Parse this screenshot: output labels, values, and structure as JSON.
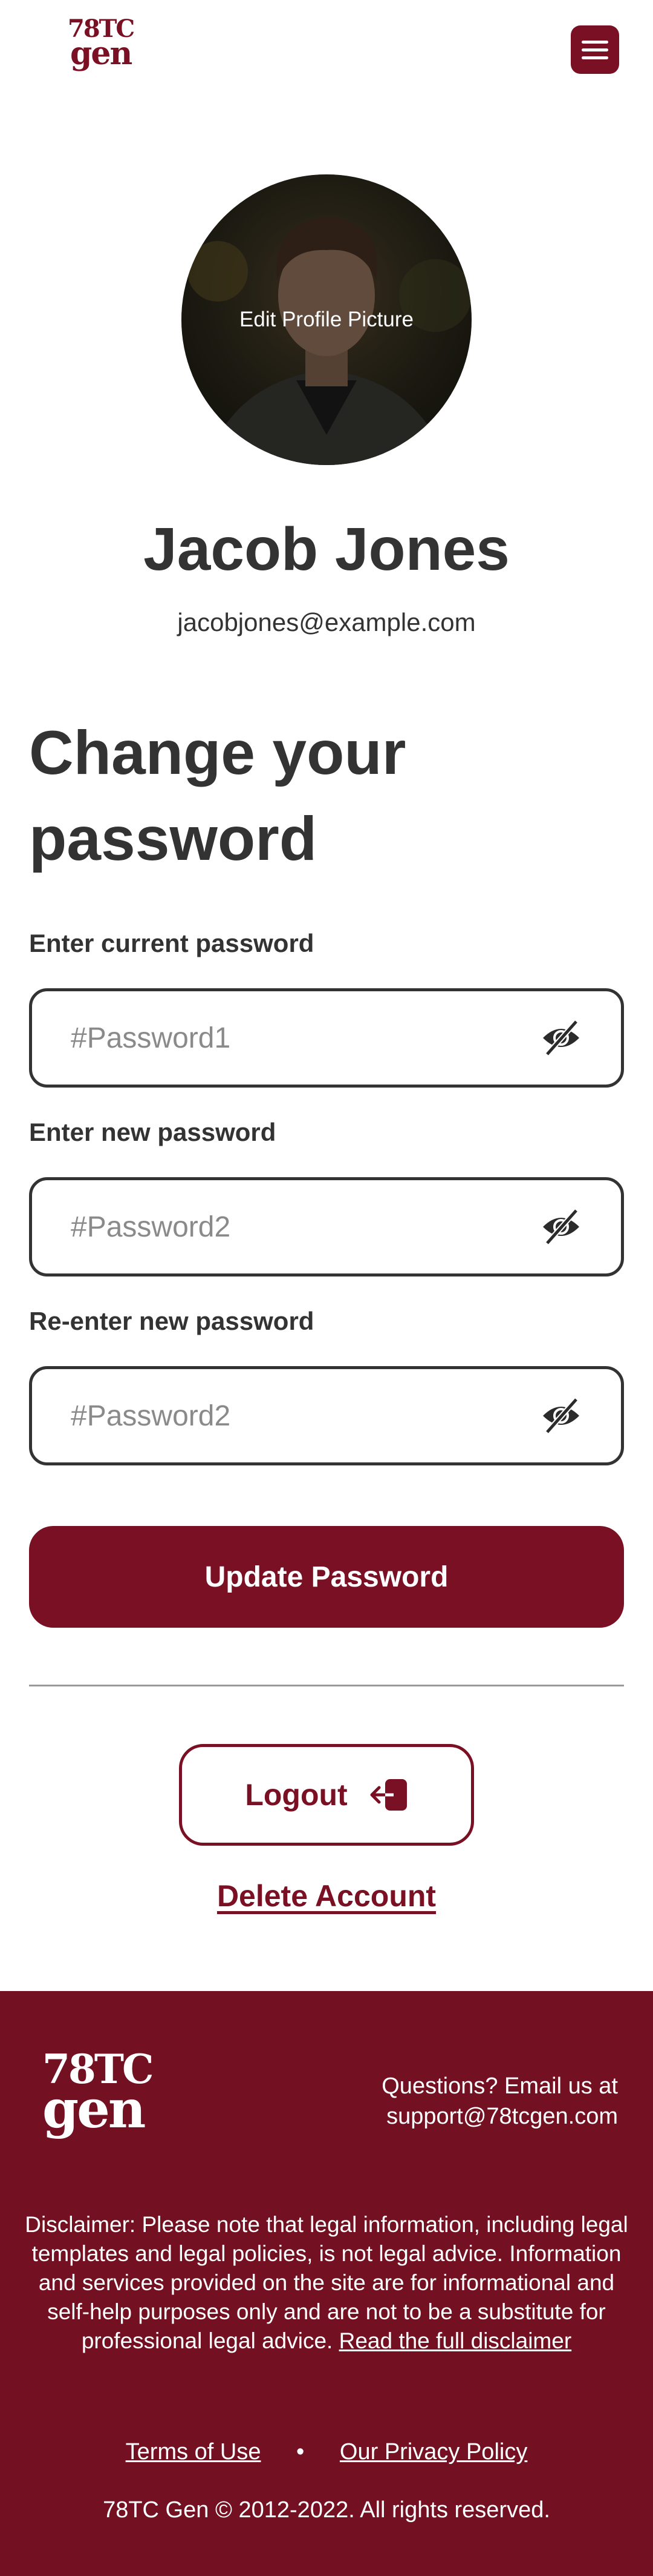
{
  "brand": {
    "logo_line1": "78TC",
    "logo_line2": "gen"
  },
  "header": {
    "menu_icon": "hamburger-menu-icon"
  },
  "profile": {
    "edit_picture_label": "Edit Profile Picture",
    "name": "Jacob Jones",
    "email": "jacobjones@example.com"
  },
  "password_form": {
    "title_line1": "Change your",
    "title_line2": "password",
    "fields": [
      {
        "label": "Enter current password",
        "placeholder": "#Password1",
        "icon": "eye-slash-icon"
      },
      {
        "label": "Enter new password",
        "placeholder": "#Password2",
        "icon": "eye-slash-icon"
      },
      {
        "label": "Re-enter new password",
        "placeholder": "#Password2",
        "icon": "eye-slash-icon"
      }
    ],
    "submit_label": "Update Password"
  },
  "account_actions": {
    "logout_label": "Logout",
    "logout_icon": "logout-icon",
    "delete_label": "Delete Account"
  },
  "footer": {
    "contact_line1": "Questions? Email us at",
    "contact_line2": "support@78tcgen.com",
    "disclaimer_text": "Disclaimer: Please note that legal information, including legal templates and legal policies, is not legal advice. Information and services provided on the site are for informational and self-help purposes only and are not to be a substitute for professional legal advice.",
    "disclaimer_link": "Read the full disclaimer",
    "terms_label": "Terms of Use",
    "separator": "•",
    "privacy_label": "Our Privacy Policy",
    "copyright": "78TC Gen © 2012-2022. All rights reserved."
  },
  "colors": {
    "brand": "#7a1023",
    "footer_bg": "#731021",
    "text": "#333333",
    "white": "#ffffff"
  }
}
